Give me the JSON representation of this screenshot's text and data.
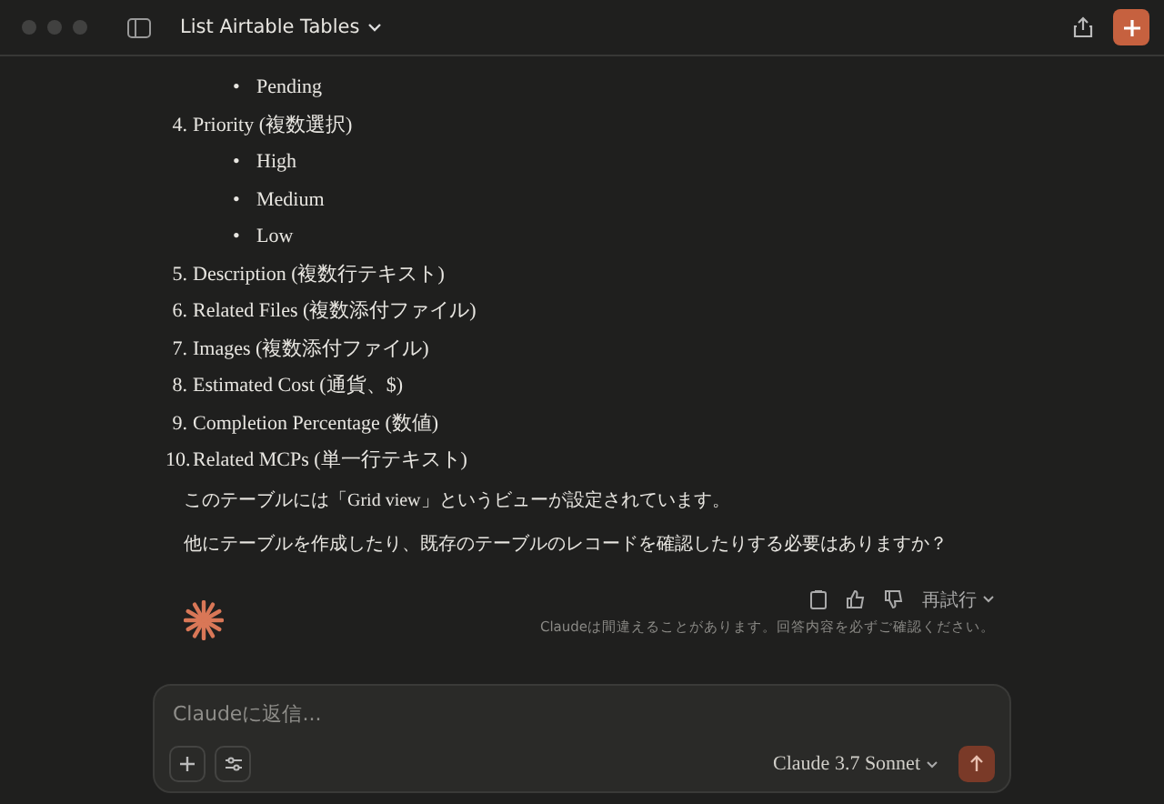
{
  "window": {
    "title": "List Airtable Tables"
  },
  "message": {
    "status_items": [
      {
        "marker": "•",
        "text": "Pending"
      }
    ],
    "fields": [
      {
        "number": "4.",
        "label": "Priority (複数選択)",
        "options": [
          {
            "marker": "•",
            "text": "High"
          },
          {
            "marker": "•",
            "text": "Medium"
          },
          {
            "marker": "•",
            "text": "Low"
          }
        ]
      },
      {
        "number": "5.",
        "label": "Description (複数行テキスト)"
      },
      {
        "number": "6.",
        "label": "Related Files (複数添付ファイル)"
      },
      {
        "number": "7.",
        "label": "Images (複数添付ファイル)"
      },
      {
        "number": "8.",
        "label": "Estimated Cost (通貨、$)"
      },
      {
        "number": "9.",
        "label": "Completion Percentage (数値)"
      },
      {
        "number": "10.",
        "label": "Related MCPs (単一行テキスト)"
      }
    ],
    "paragraphs": [
      "このテーブルには「Grid view」というビューが設定されています。",
      "他にテーブルを作成したり、既存のテーブルのレコードを確認したりする必要はありますか？"
    ],
    "retry": "再試行",
    "disclaimer": "Claudeは間違えることがあります。回答内容を必ずご確認ください。"
  },
  "composer": {
    "placeholder": "Claudeに返信...",
    "model": "Claude 3.7 Sonnet"
  }
}
